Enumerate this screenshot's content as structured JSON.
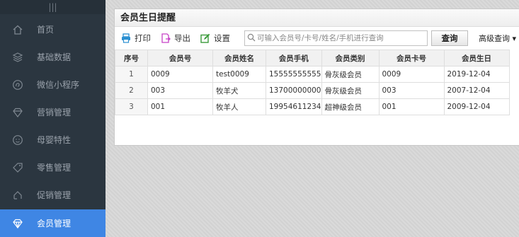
{
  "sidebar": {
    "top_icon": "menu-bars-icon",
    "items": [
      {
        "label": "首页",
        "icon": "home-icon"
      },
      {
        "label": "基础数据",
        "icon": "layers-icon"
      },
      {
        "label": "微信小程序",
        "icon": "wechat-icon"
      },
      {
        "label": "营销管理",
        "icon": "diamond-icon"
      },
      {
        "label": "母婴特性",
        "icon": "baby-icon"
      },
      {
        "label": "零售管理",
        "icon": "tag-icon"
      },
      {
        "label": "促销管理",
        "icon": "promo-icon"
      },
      {
        "label": "会员管理",
        "icon": "member-diamond-icon"
      }
    ],
    "active_index": 7,
    "active_color": "#3f86e4"
  },
  "panel": {
    "title": "会员生日提醒"
  },
  "toolbar": {
    "print_label": "打印",
    "export_label": "导出",
    "settings_label": "设置",
    "search_placeholder": "可输入会员号/卡号/姓名/手机进行查询",
    "search_value": "",
    "query_label": "查询",
    "advanced_label": "高级查询 ▾"
  },
  "table": {
    "headers": [
      "序号",
      "会员号",
      "会员姓名",
      "会员手机",
      "会员类别",
      "会员卡号",
      "会员生日"
    ],
    "rows": [
      [
        "1",
        "0009",
        "test0009",
        "15555555555",
        "骨灰级会员",
        "0009",
        "2019-12-04"
      ],
      [
        "2",
        "003",
        "牧羊犬",
        "13700000000",
        "骨灰级会员",
        "003",
        "2007-12-04"
      ],
      [
        "3",
        "001",
        "牧羊人",
        "19954611234",
        "超神级会员",
        "001",
        "2009-12-04"
      ]
    ]
  }
}
